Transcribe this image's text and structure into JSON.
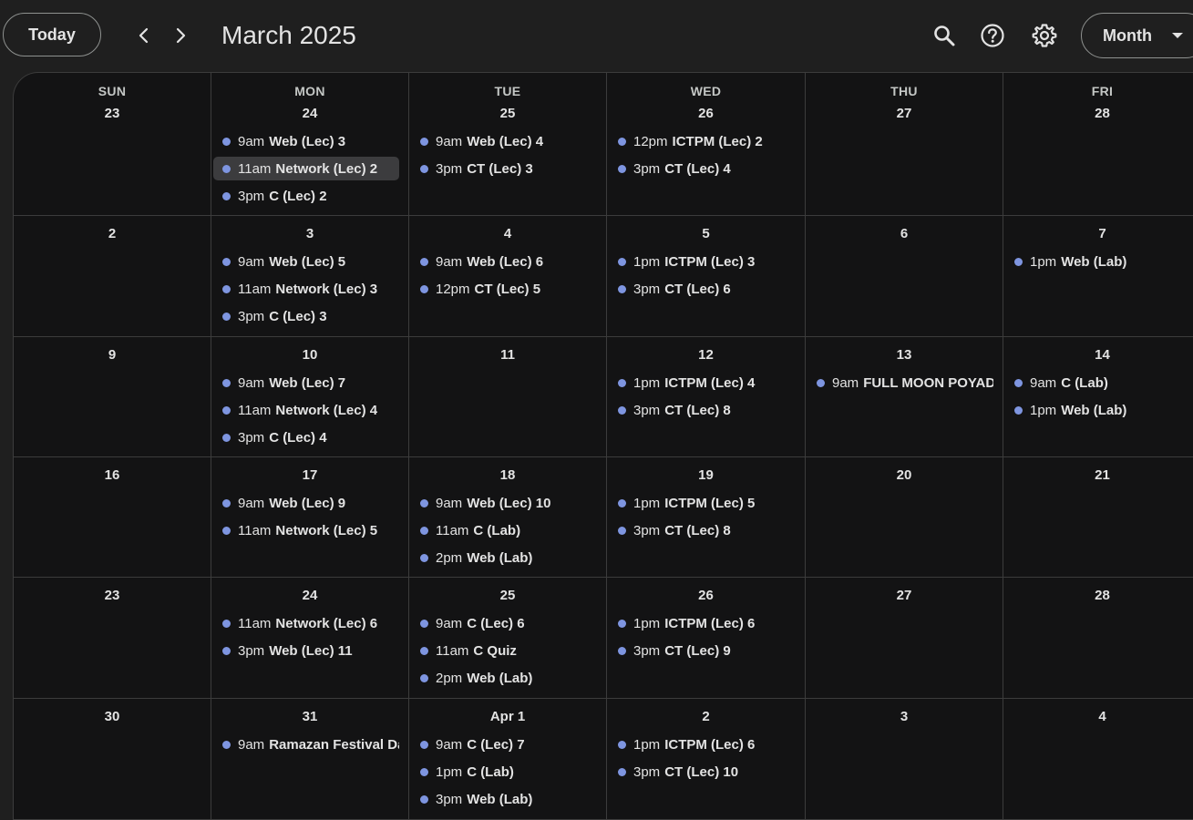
{
  "header": {
    "today_label": "Today",
    "month_title": "March 2025",
    "view_label": "Month",
    "icons": {
      "prev": "chevron-left-icon",
      "next": "chevron-right-icon",
      "search": "search-icon",
      "help": "help-icon",
      "settings": "gear-icon",
      "view_dropdown": "caret-down-icon"
    }
  },
  "colors": {
    "event_dot": "#7e95e0",
    "background": "#1f1f1f",
    "grid_background": "#131314"
  },
  "weekdays": [
    "SUN",
    "MON",
    "TUE",
    "WED",
    "THU",
    "FRI"
  ],
  "weeks": [
    {
      "days": [
        {
          "label": "23",
          "events": []
        },
        {
          "label": "24",
          "events": [
            {
              "time": "9am",
              "title": "Web (Lec) 3"
            },
            {
              "time": "11am",
              "title": "Network (Lec) 2",
              "selected": true
            },
            {
              "time": "3pm",
              "title": "C (Lec) 2"
            }
          ]
        },
        {
          "label": "25",
          "events": [
            {
              "time": "9am",
              "title": "Web (Lec) 4"
            },
            {
              "time": "3pm",
              "title": "CT (Lec) 3"
            }
          ]
        },
        {
          "label": "26",
          "events": [
            {
              "time": "12pm",
              "title": "ICTPM (Lec) 2"
            },
            {
              "time": "3pm",
              "title": "CT (Lec) 4"
            }
          ]
        },
        {
          "label": "27",
          "events": []
        },
        {
          "label": "28",
          "events": []
        }
      ]
    },
    {
      "days": [
        {
          "label": "2",
          "events": []
        },
        {
          "label": "3",
          "events": [
            {
              "time": "9am",
              "title": "Web (Lec) 5"
            },
            {
              "time": "11am",
              "title": "Network (Lec) 3"
            },
            {
              "time": "3pm",
              "title": "C (Lec) 3"
            }
          ]
        },
        {
          "label": "4",
          "events": [
            {
              "time": "9am",
              "title": "Web (Lec) 6"
            },
            {
              "time": "12pm",
              "title": "CT (Lec) 5"
            }
          ]
        },
        {
          "label": "5",
          "events": [
            {
              "time": "1pm",
              "title": "ICTPM (Lec) 3"
            },
            {
              "time": "3pm",
              "title": "CT (Lec) 6"
            }
          ]
        },
        {
          "label": "6",
          "events": []
        },
        {
          "label": "7",
          "events": [
            {
              "time": "1pm",
              "title": "Web (Lab)"
            }
          ]
        }
      ]
    },
    {
      "days": [
        {
          "label": "9",
          "events": []
        },
        {
          "label": "10",
          "events": [
            {
              "time": "9am",
              "title": "Web (Lec) 7"
            },
            {
              "time": "11am",
              "title": "Network (Lec) 4"
            },
            {
              "time": "3pm",
              "title": "C (Lec) 4"
            }
          ]
        },
        {
          "label": "11",
          "events": []
        },
        {
          "label": "12",
          "events": [
            {
              "time": "1pm",
              "title": "ICTPM (Lec) 4"
            },
            {
              "time": "3pm",
              "title": "CT (Lec) 8"
            }
          ]
        },
        {
          "label": "13",
          "events": [
            {
              "time": "9am",
              "title": "FULL MOON POYADAY"
            }
          ]
        },
        {
          "label": "14",
          "events": [
            {
              "time": "9am",
              "title": "C (Lab)"
            },
            {
              "time": "1pm",
              "title": "Web (Lab)"
            }
          ]
        }
      ]
    },
    {
      "days": [
        {
          "label": "16",
          "events": []
        },
        {
          "label": "17",
          "events": [
            {
              "time": "9am",
              "title": "Web (Lec) 9"
            },
            {
              "time": "11am",
              "title": "Network (Lec) 5"
            }
          ]
        },
        {
          "label": "18",
          "events": [
            {
              "time": "9am",
              "title": "Web (Lec) 10"
            },
            {
              "time": "11am",
              "title": "C (Lab)"
            },
            {
              "time": "2pm",
              "title": "Web (Lab)"
            }
          ]
        },
        {
          "label": "19",
          "events": [
            {
              "time": "1pm",
              "title": "ICTPM (Lec) 5"
            },
            {
              "time": "3pm",
              "title": "CT (Lec) 8"
            }
          ]
        },
        {
          "label": "20",
          "events": []
        },
        {
          "label": "21",
          "events": []
        }
      ]
    },
    {
      "days": [
        {
          "label": "23",
          "events": []
        },
        {
          "label": "24",
          "events": [
            {
              "time": "11am",
              "title": "Network (Lec) 6"
            },
            {
              "time": "3pm",
              "title": "Web (Lec) 11"
            }
          ]
        },
        {
          "label": "25",
          "events": [
            {
              "time": "9am",
              "title": "C (Lec) 6"
            },
            {
              "time": "11am",
              "title": "C Quiz"
            },
            {
              "time": "2pm",
              "title": "Web (Lab)"
            }
          ]
        },
        {
          "label": "26",
          "events": [
            {
              "time": "1pm",
              "title": "ICTPM (Lec) 6"
            },
            {
              "time": "3pm",
              "title": "CT (Lec) 9"
            }
          ]
        },
        {
          "label": "27",
          "events": []
        },
        {
          "label": "28",
          "events": []
        }
      ]
    },
    {
      "days": [
        {
          "label": "30",
          "events": []
        },
        {
          "label": "31",
          "events": [
            {
              "time": "9am",
              "title": "Ramazan Festival Day"
            }
          ]
        },
        {
          "label": "Apr 1",
          "events": [
            {
              "time": "9am",
              "title": "C (Lec) 7"
            },
            {
              "time": "1pm",
              "title": "C (Lab)"
            },
            {
              "time": "3pm",
              "title": "Web (Lab)"
            }
          ]
        },
        {
          "label": "2",
          "events": [
            {
              "time": "1pm",
              "title": "ICTPM (Lec) 6"
            },
            {
              "time": "3pm",
              "title": "CT (Lec) 10"
            }
          ]
        },
        {
          "label": "3",
          "events": []
        },
        {
          "label": "4",
          "events": []
        }
      ]
    }
  ]
}
